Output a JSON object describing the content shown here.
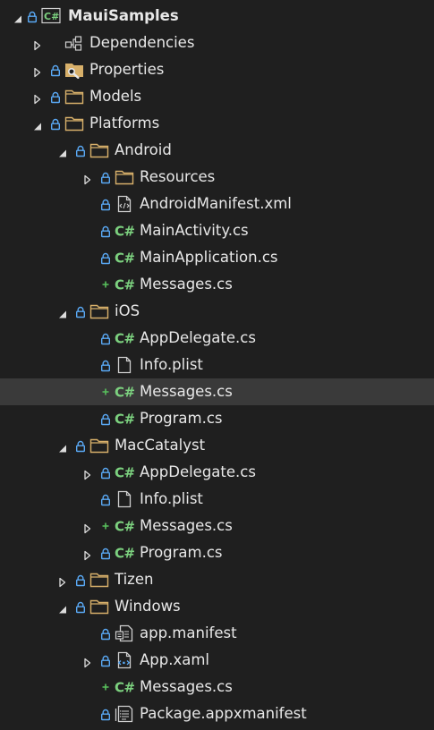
{
  "tree": {
    "items": [
      {
        "id": "root",
        "label": "MauiSamples",
        "depth": 0,
        "chevron": "expanded",
        "prefix": "lock",
        "icon": "csharp-project-icon",
        "bold": true
      },
      {
        "id": "dependencies",
        "label": "Dependencies",
        "depth": 1,
        "chevron": "collapsed",
        "prefix": "none",
        "icon": "dependencies-icon"
      },
      {
        "id": "properties",
        "label": "Properties",
        "depth": 1,
        "chevron": "collapsed",
        "prefix": "lock",
        "icon": "properties-folder-icon"
      },
      {
        "id": "models",
        "label": "Models",
        "depth": 1,
        "chevron": "collapsed",
        "prefix": "lock",
        "icon": "folder-icon"
      },
      {
        "id": "platforms",
        "label": "Platforms",
        "depth": 1,
        "chevron": "expanded",
        "prefix": "lock",
        "icon": "folder-icon"
      },
      {
        "id": "android",
        "label": "Android",
        "depth": 2,
        "chevron": "expanded",
        "prefix": "lock",
        "icon": "folder-icon"
      },
      {
        "id": "android-resources",
        "label": "Resources",
        "depth": 3,
        "chevron": "collapsed",
        "prefix": "lock",
        "icon": "folder-icon"
      },
      {
        "id": "android-manifest",
        "label": "AndroidManifest.xml",
        "depth": 3,
        "chevron": "none",
        "prefix": "lock",
        "icon": "xml-file-icon"
      },
      {
        "id": "main-activity",
        "label": "MainActivity.cs",
        "depth": 3,
        "chevron": "none",
        "prefix": "lock",
        "icon": "csharp-file-icon"
      },
      {
        "id": "main-application",
        "label": "MainApplication.cs",
        "depth": 3,
        "chevron": "none",
        "prefix": "lock",
        "icon": "csharp-file-icon"
      },
      {
        "id": "android-messages",
        "label": "Messages.cs",
        "depth": 3,
        "chevron": "none",
        "prefix": "plus",
        "icon": "csharp-file-icon"
      },
      {
        "id": "ios",
        "label": "iOS",
        "depth": 2,
        "chevron": "expanded",
        "prefix": "lock",
        "icon": "folder-icon"
      },
      {
        "id": "ios-appdelegate",
        "label": "AppDelegate.cs",
        "depth": 3,
        "chevron": "none",
        "prefix": "lock",
        "icon": "csharp-file-icon"
      },
      {
        "id": "ios-infoplist",
        "label": "Info.plist",
        "depth": 3,
        "chevron": "none",
        "prefix": "lock",
        "icon": "file-icon"
      },
      {
        "id": "ios-messages",
        "label": "Messages.cs",
        "depth": 3,
        "chevron": "none",
        "prefix": "plus",
        "icon": "csharp-file-icon",
        "selected": true
      },
      {
        "id": "ios-program",
        "label": "Program.cs",
        "depth": 3,
        "chevron": "none",
        "prefix": "lock",
        "icon": "csharp-file-icon"
      },
      {
        "id": "maccatalyst",
        "label": "MacCatalyst",
        "depth": 2,
        "chevron": "expanded",
        "prefix": "lock",
        "icon": "folder-icon"
      },
      {
        "id": "mac-appdelegate",
        "label": "AppDelegate.cs",
        "depth": 3,
        "chevron": "collapsed",
        "prefix": "lock",
        "icon": "csharp-file-icon"
      },
      {
        "id": "mac-infoplist",
        "label": "Info.plist",
        "depth": 3,
        "chevron": "none",
        "prefix": "lock",
        "icon": "file-icon"
      },
      {
        "id": "mac-messages",
        "label": "Messages.cs",
        "depth": 3,
        "chevron": "collapsed",
        "prefix": "plus",
        "icon": "csharp-file-icon"
      },
      {
        "id": "mac-program",
        "label": "Program.cs",
        "depth": 3,
        "chevron": "collapsed",
        "prefix": "lock",
        "icon": "csharp-file-icon"
      },
      {
        "id": "tizen",
        "label": "Tizen",
        "depth": 2,
        "chevron": "collapsed",
        "prefix": "lock",
        "icon": "folder-icon"
      },
      {
        "id": "windows",
        "label": "Windows",
        "depth": 2,
        "chevron": "expanded",
        "prefix": "lock",
        "icon": "folder-icon"
      },
      {
        "id": "app-manifest",
        "label": "app.manifest",
        "depth": 3,
        "chevron": "none",
        "prefix": "lock",
        "icon": "manifest-file-icon"
      },
      {
        "id": "app-xaml",
        "label": "App.xaml",
        "depth": 3,
        "chevron": "collapsed",
        "prefix": "lock",
        "icon": "xaml-file-icon"
      },
      {
        "id": "windows-messages",
        "label": "Messages.cs",
        "depth": 3,
        "chevron": "none",
        "prefix": "plus",
        "icon": "csharp-file-icon"
      },
      {
        "id": "package-appxmanifest",
        "label": "Package.appxmanifest",
        "depth": 3,
        "chevron": "none",
        "prefix": "lock",
        "icon": "appxmanifest-file-icon"
      }
    ]
  },
  "colors": {
    "background": "#1f1f1f",
    "selected_row": "#3a3a3a",
    "text": "#e8e8e8",
    "lock_blue": "#5aa9f5",
    "added_green": "#58c05c",
    "csharp_green": "#7cd17f",
    "folder_tan": "#d8b06a"
  }
}
